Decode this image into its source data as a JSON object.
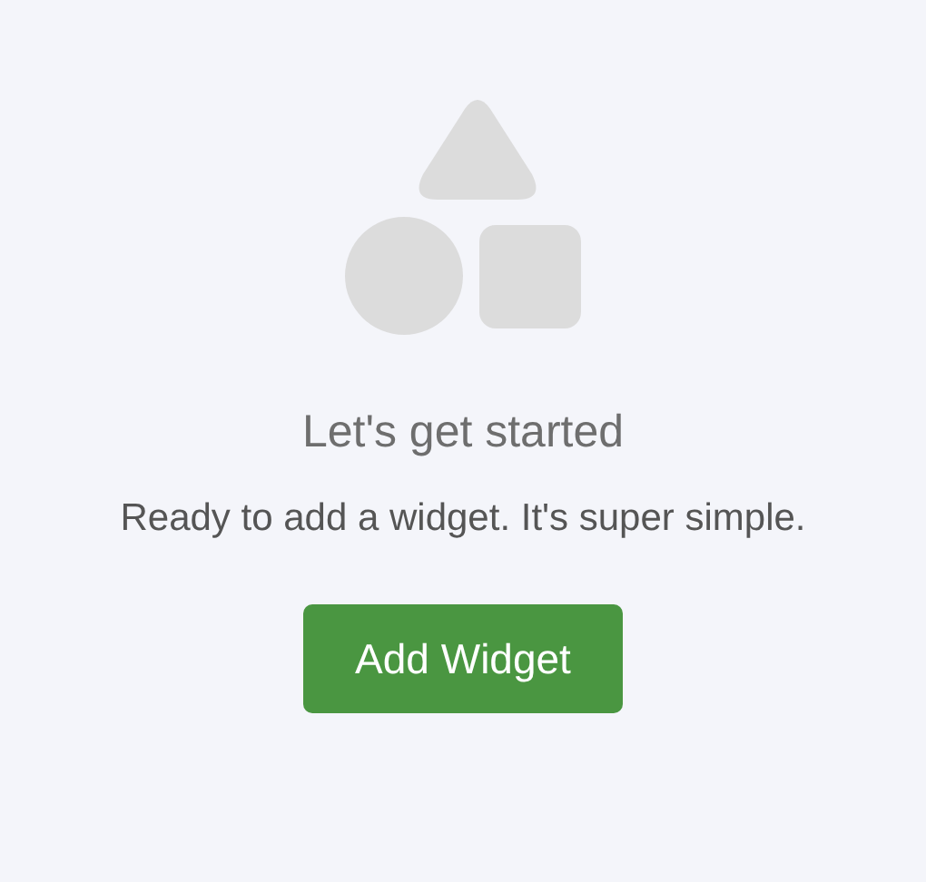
{
  "empty_state": {
    "title": "Let's get started",
    "message": "Ready to add a widget. It's super simple.",
    "button": "Add Widget"
  }
}
